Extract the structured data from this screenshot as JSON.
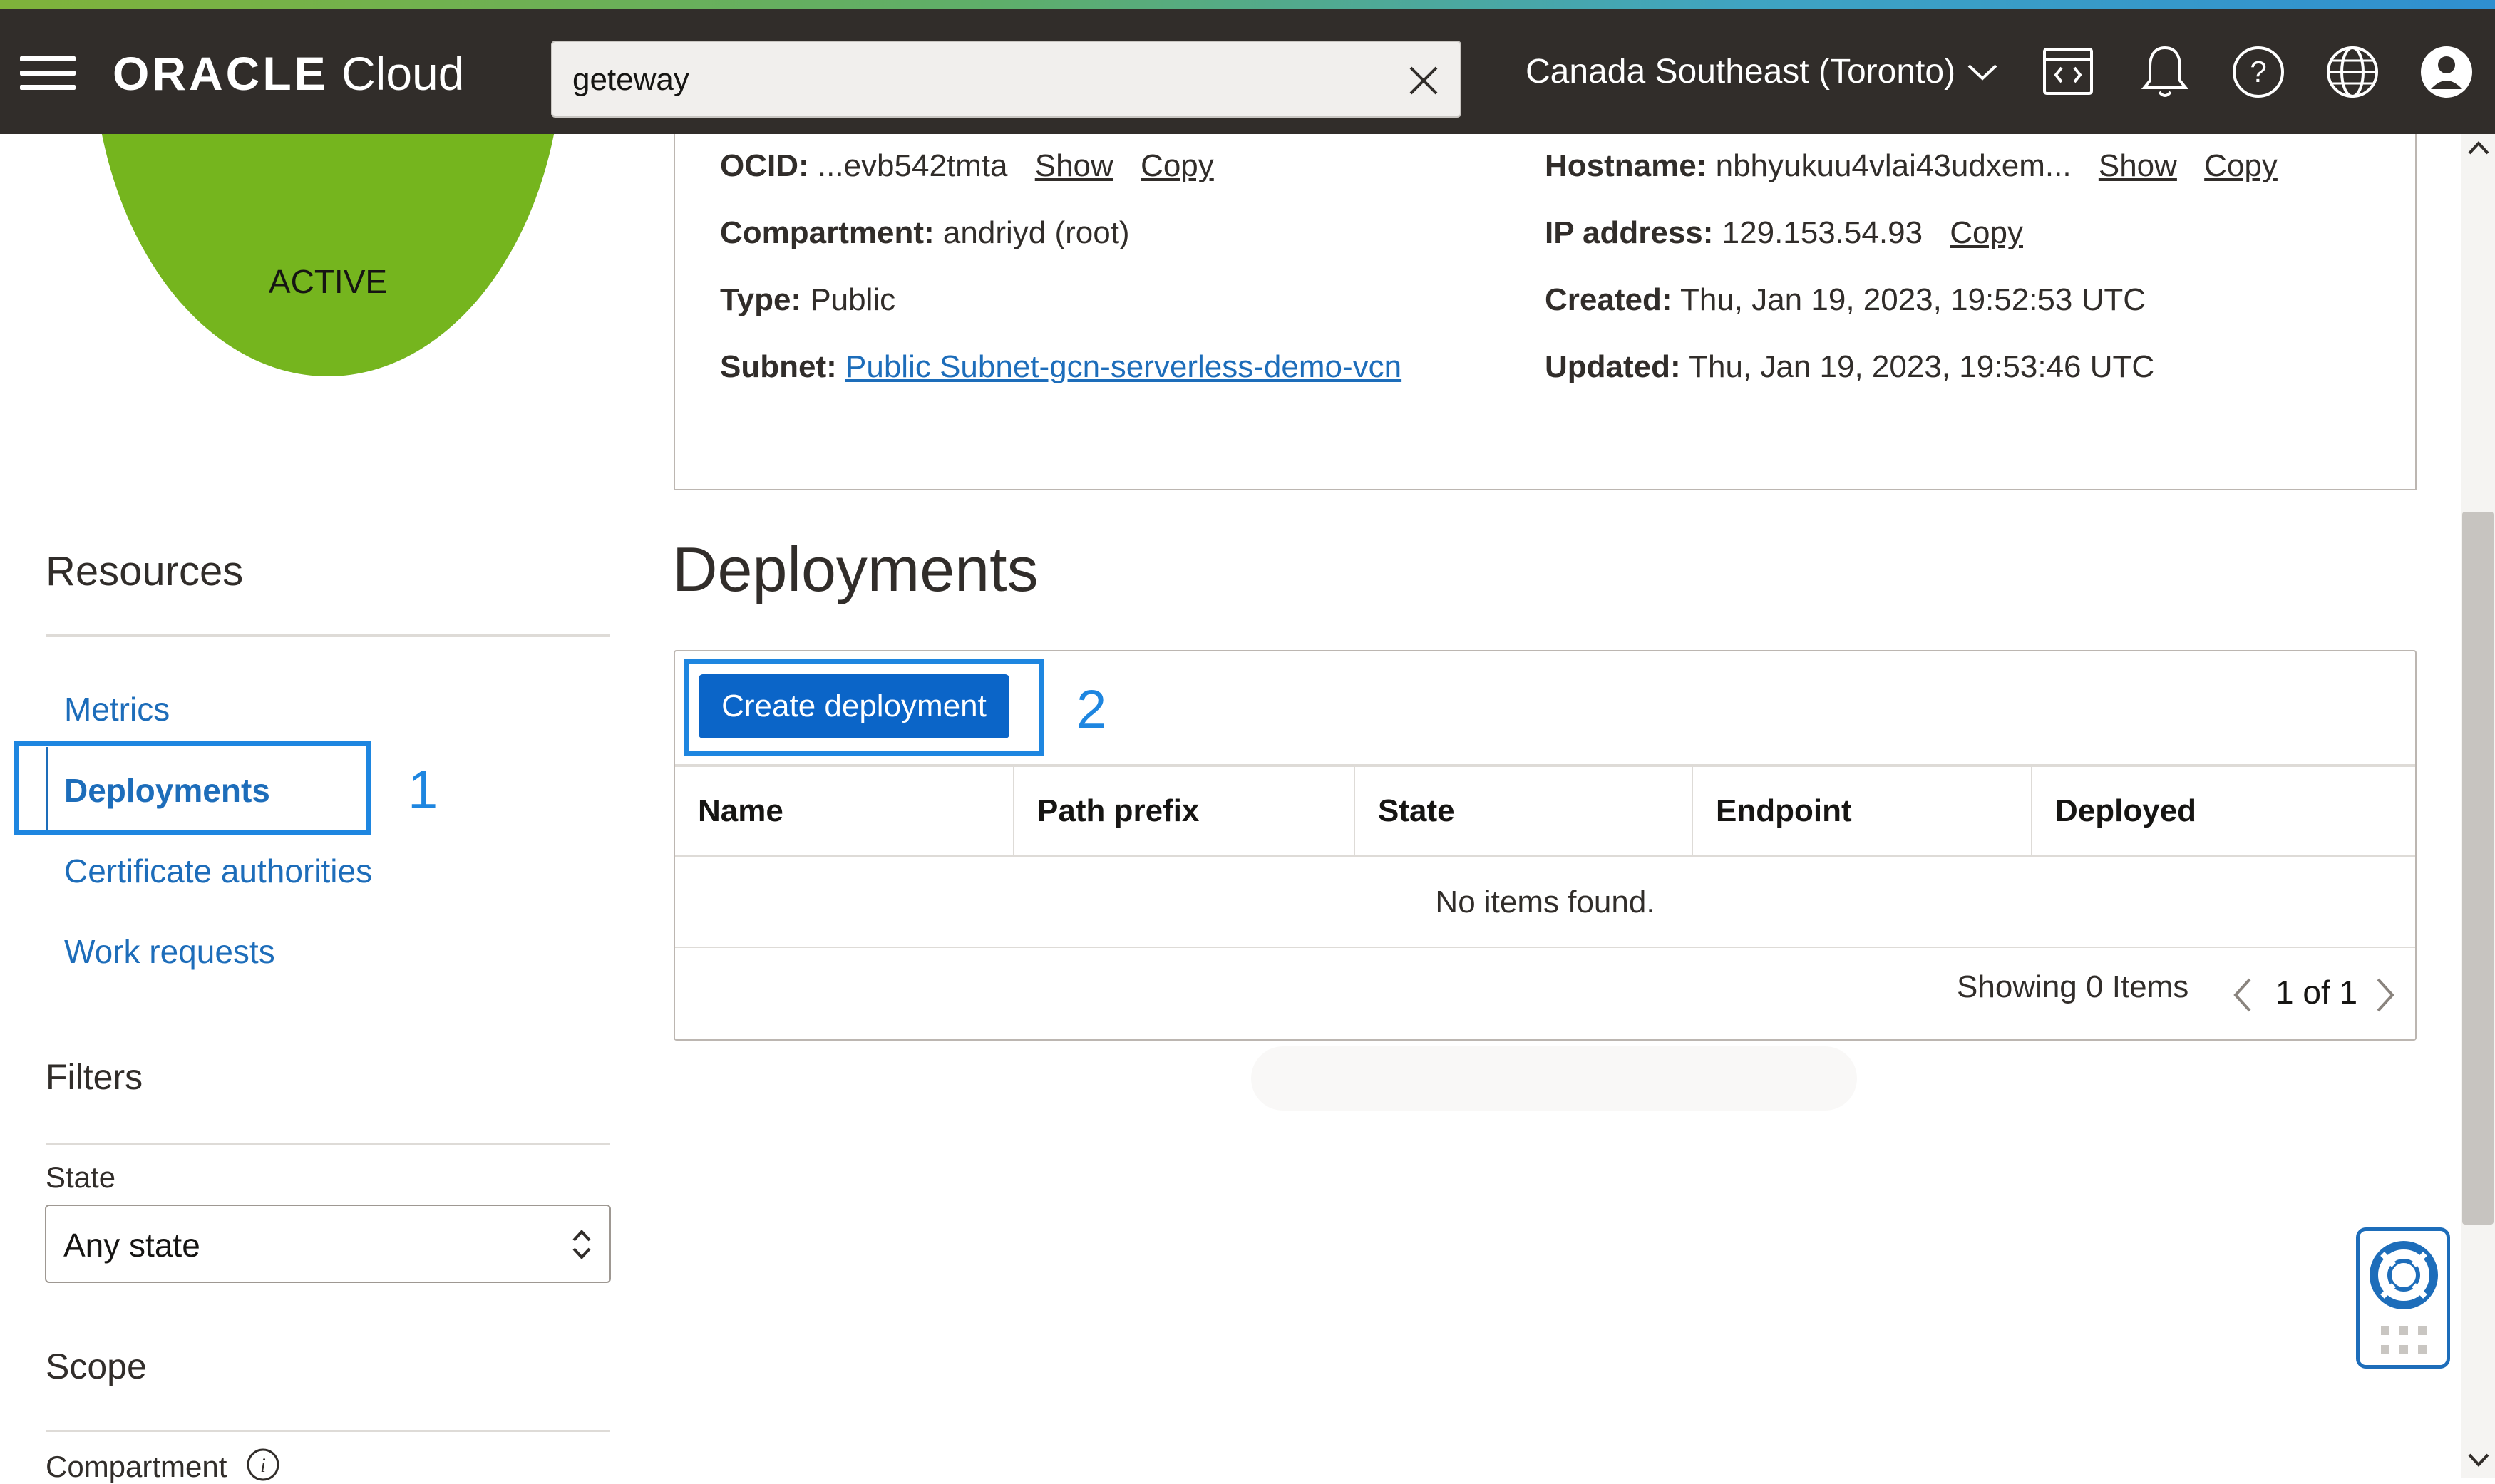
{
  "header": {
    "brand_oracle": "ORACLE",
    "brand_cloud": "Cloud",
    "search_value": "geteway",
    "region": "Canada Southeast (Toronto)"
  },
  "sidebar": {
    "status": "ACTIVE",
    "status_color": "#75b51e",
    "resources_heading": "Resources",
    "items": [
      {
        "label": "Metrics"
      },
      {
        "label": "Deployments"
      },
      {
        "label": "Certificate authorities"
      },
      {
        "label": "Work requests"
      }
    ],
    "filters_heading": "Filters",
    "state_label": "State",
    "state_value": "Any state",
    "scope_heading": "Scope",
    "compartment_label": "Compartment"
  },
  "annotations": {
    "step1": "1",
    "step2": "2",
    "color": "#1e86e0"
  },
  "details": {
    "ocid_label": "OCID:",
    "ocid_value": "...evb542tmta",
    "show": "Show",
    "copy": "Copy",
    "compartment_label": "Compartment:",
    "compartment_value": "andriyd (root)",
    "type_label": "Type:",
    "type_value": "Public",
    "subnet_label": "Subnet:",
    "subnet_value": "Public Subnet-gcn-serverless-demo-vcn",
    "hostname_label": "Hostname:",
    "hostname_value": "nbhyukuu4vlai43udxem...",
    "ip_label": "IP address:",
    "ip_value": "129.153.54.93",
    "created_label": "Created:",
    "created_value": "Thu, Jan 19, 2023, 19:52:53 UTC",
    "updated_label": "Updated:",
    "updated_value": "Thu, Jan 19, 2023, 19:53:46 UTC"
  },
  "deployments": {
    "title": "Deployments",
    "create_button": "Create deployment",
    "columns": [
      "Name",
      "Path prefix",
      "State",
      "Endpoint",
      "Deployed"
    ],
    "empty_message": "No items found.",
    "showing": "Showing 0 Items",
    "page": "1 of 1"
  }
}
